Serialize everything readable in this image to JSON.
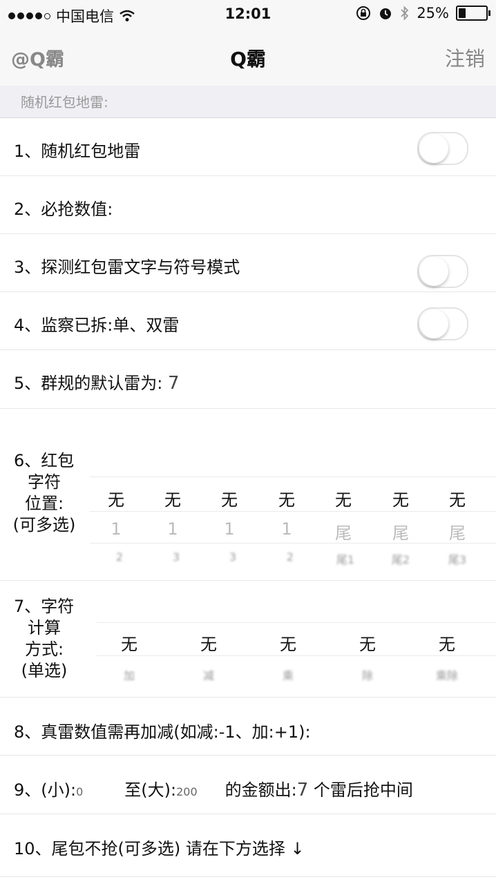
{
  "status_bar": {
    "carrier": "中国电信",
    "time": "12:01",
    "battery_percent": "25%",
    "battery_level": 0.25,
    "icons": [
      "signal-dots",
      "wifi-icon",
      "orientation-lock-icon",
      "alarm-icon",
      "bluetooth-icon",
      "battery-icon"
    ]
  },
  "nav": {
    "left": "@Q霸",
    "title": "Q霸",
    "right": "注销"
  },
  "section_header": "随机红包地雷:",
  "rows": [
    {
      "label": "1、随机红包地雷",
      "toggle": false
    },
    {
      "label": "2、必抢数值:"
    },
    {
      "label": "3、探测红包雷文字与符号模式",
      "toggle": false
    },
    {
      "label": "4、监察已拆:单、双雷",
      "toggle": false
    },
    {
      "label": "5、群规的默认雷为:",
      "value": "7"
    }
  ],
  "position_grid": {
    "label_lines": [
      "6、红包",
      "字符",
      "位置:",
      "(可多选)"
    ],
    "options": [
      {
        "top": "无",
        "mid": "1",
        "bottom": "2"
      },
      {
        "top": "无",
        "mid": "1",
        "bottom": "3"
      },
      {
        "top": "无",
        "mid": "1",
        "bottom": "3"
      },
      {
        "top": "无",
        "mid": "1",
        "bottom": "2"
      },
      {
        "top": "无",
        "mid": "尾",
        "bottom": "尾1"
      },
      {
        "top": "无",
        "mid": "尾",
        "bottom": "尾2"
      },
      {
        "top": "无",
        "mid": "尾",
        "bottom": "尾3"
      }
    ]
  },
  "calc_grid": {
    "label_lines": [
      "7、字符",
      "计算",
      "方式:",
      "(单选)"
    ],
    "options": [
      {
        "top": "无",
        "bottom": "加"
      },
      {
        "top": "无",
        "bottom": "减"
      },
      {
        "top": "无",
        "bottom": "乘"
      },
      {
        "top": "无",
        "bottom": "除"
      },
      {
        "top": "无",
        "bottom": "乘除"
      }
    ]
  },
  "row8": {
    "label": "8、真雷数值需再加减(如减:-1、加:+1):"
  },
  "row9": {
    "prefix": "9、(小):",
    "min_value": "0",
    "mid": "至(大):",
    "max_value": "200",
    "suffix_a": "的金额出:",
    "mine_value": "7",
    "suffix_b": "个雷后抢中间"
  },
  "row10": {
    "label": "10、尾包不抢(可多选) 请在下方选择",
    "arrow": "↓"
  }
}
